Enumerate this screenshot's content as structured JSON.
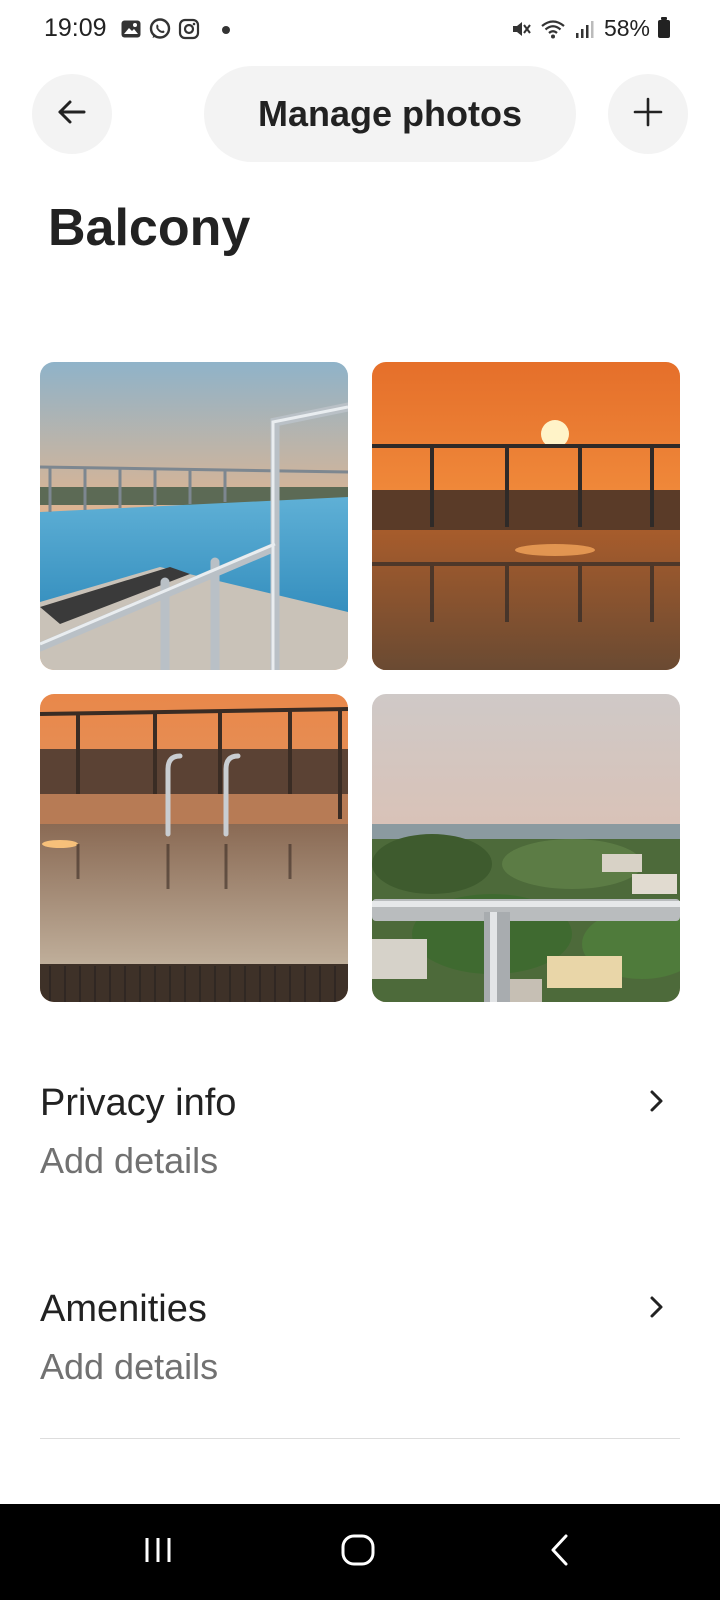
{
  "status_bar": {
    "time": "19:09",
    "battery": "58%",
    "left_icons": [
      "gallery-icon",
      "whatsapp-icon",
      "instagram-icon"
    ],
    "right_icons": [
      "mute-icon",
      "wifi-icon",
      "signal-icon"
    ]
  },
  "header": {
    "title": "Manage photos",
    "back_icon": "arrow-left-icon",
    "add_icon": "plus-icon"
  },
  "room": {
    "title": "Balcony"
  },
  "photos": [
    {
      "subject": "rooftop pool with railing at sunset"
    },
    {
      "subject": "sunset over pool with railing"
    },
    {
      "subject": "pool ladder at sunset"
    },
    {
      "subject": "view of town and trees from railing"
    }
  ],
  "details": [
    {
      "title": "Privacy info",
      "subtitle": "Add details"
    },
    {
      "title": "Amenities",
      "subtitle": "Add details"
    }
  ],
  "nav": {
    "recents_icon": "recents-icon",
    "home_icon": "home-icon",
    "back_icon": "back-icon"
  },
  "colors": {
    "text": "#222222",
    "secondary_text": "#717171",
    "pill_background": "#f3f3f3",
    "nav_background": "#000000"
  }
}
